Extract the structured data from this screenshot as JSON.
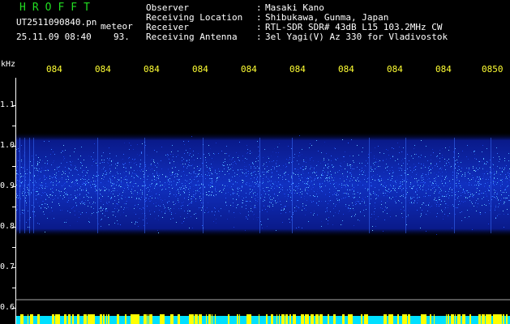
{
  "header": {
    "app_title": "HROFFT",
    "filename": "UT2511090840.pn",
    "type_label": "meteor",
    "datetime": "25.11.09 08:40",
    "value": "93."
  },
  "info": [
    {
      "label": "Observer",
      "sep": ":",
      "value": "Masaki Kano"
    },
    {
      "label": "Receiving Location",
      "sep": ":",
      "value": "Shibukawa, Gunma, Japan"
    },
    {
      "label": "Receiver",
      "sep": ":",
      "value": "RTL-SDR SDR# 43dB L15 103.2MHz CW"
    },
    {
      "label": "Receiving Antenna",
      "sep": ":",
      "value": "3el Yagi(V) Az 330 for Vladivostok"
    }
  ],
  "time_axis": [
    "084",
    "084",
    "084",
    "084",
    "084",
    "084",
    "084",
    "084",
    "084",
    "0850"
  ],
  "freq_axis": {
    "unit": "kHz",
    "ticks": [
      "1.1",
      "1.0",
      "0.9",
      "0.8",
      "0.7",
      "0.6"
    ]
  },
  "colors": {
    "title": "#22dd22",
    "time_labels": "#ffff33",
    "signal_low": "#0a1a8a",
    "signal_high": "#4aa8ff",
    "strip_yellow": "#ffff00",
    "strip_cyan": "#00e0ff"
  }
}
